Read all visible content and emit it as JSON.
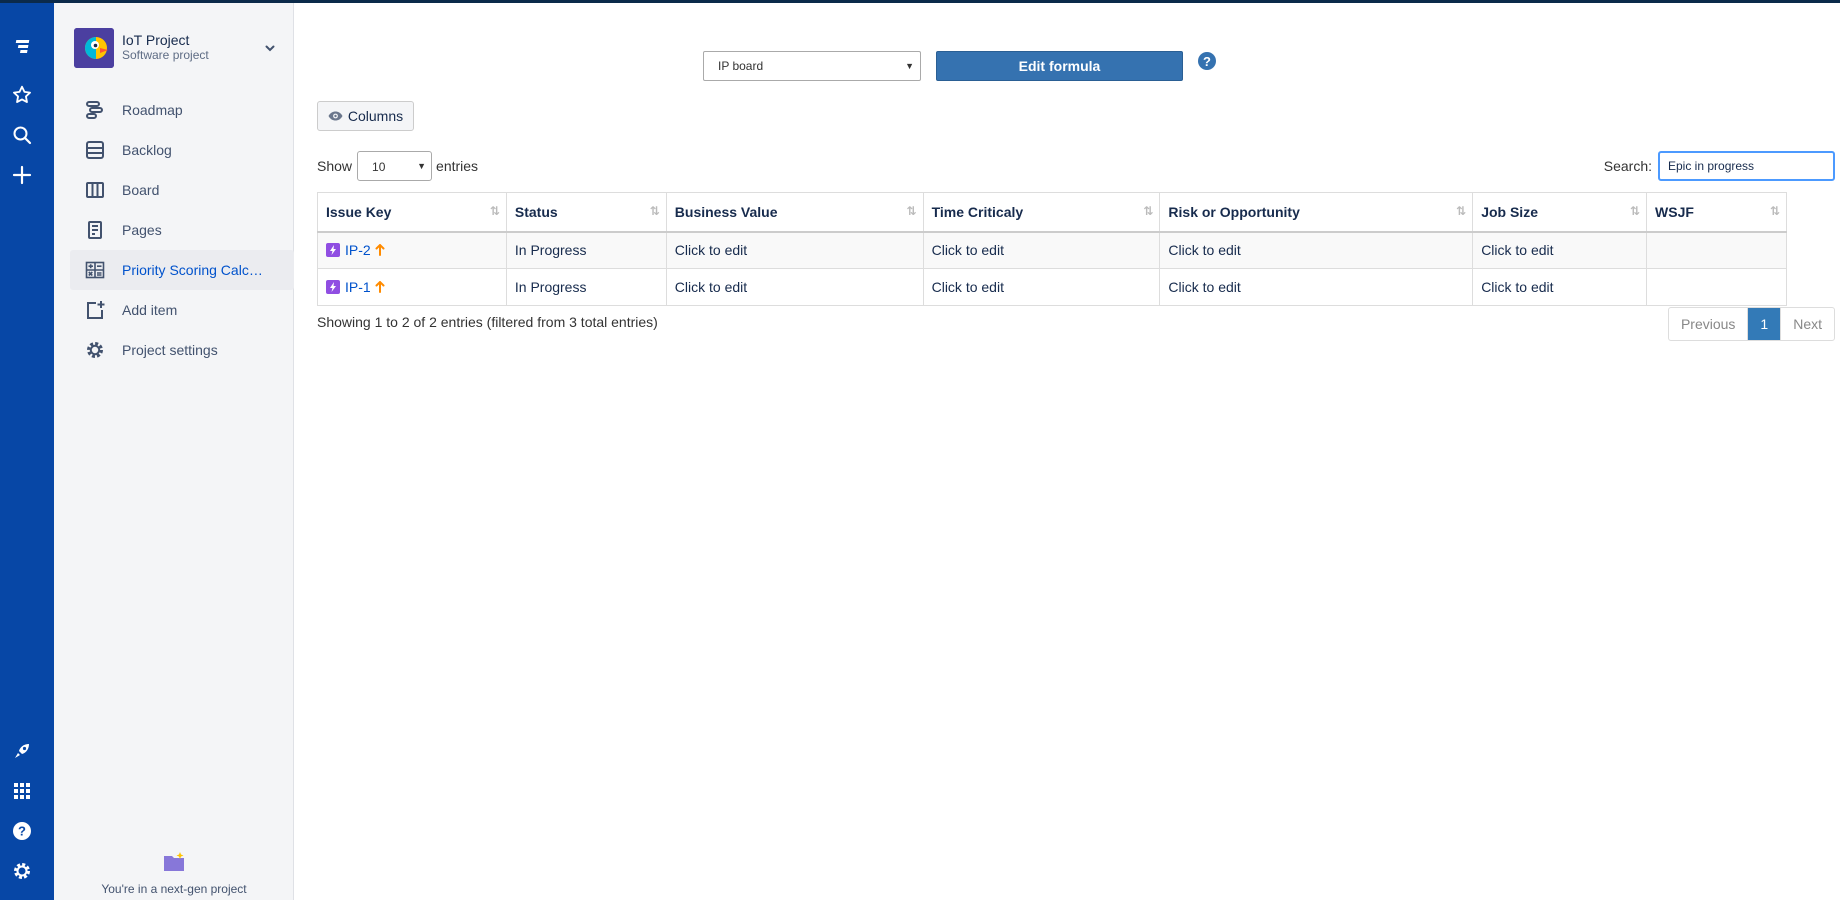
{
  "global_nav": {
    "icons": [
      "jira-logo-icon",
      "star-icon",
      "search-icon",
      "plus-icon",
      "rocket-icon",
      "apps-grid-icon",
      "help-icon",
      "settings-icon"
    ]
  },
  "project": {
    "name": "IoT Project",
    "type": "Software project"
  },
  "sidebar": {
    "items": [
      {
        "label": "Roadmap",
        "icon": "roadmap-icon"
      },
      {
        "label": "Backlog",
        "icon": "backlog-icon"
      },
      {
        "label": "Board",
        "icon": "board-icon"
      },
      {
        "label": "Pages",
        "icon": "pages-icon"
      },
      {
        "label": "Priority Scoring Calculator",
        "icon": "calculator-icon",
        "active": true
      },
      {
        "label": "Add item",
        "icon": "add-item-icon"
      },
      {
        "label": "Project settings",
        "icon": "gear-icon"
      }
    ],
    "footer_text": "You're in a next-gen project"
  },
  "toolbar": {
    "board_select": "IP board",
    "edit_formula_label": "Edit formula",
    "help_glyph": "?",
    "columns_label": "Columns"
  },
  "table_controls": {
    "show_label": "Show",
    "entries_value": "10",
    "entries_label": "entries",
    "search_label": "Search:",
    "search_value": "Epic in progress"
  },
  "table": {
    "headers": [
      "Issue Key",
      "Status",
      "Business Value",
      "Time Criticaly",
      "Risk or Opportunity",
      "Job Size",
      "WSJF"
    ],
    "rows": [
      {
        "key": "IP-2",
        "status": "In Progress",
        "business_value": "Click to edit",
        "time_criticality": "Click to edit",
        "risk": "Click to edit",
        "job_size": "Click to edit",
        "wsjf": ""
      },
      {
        "key": "IP-1",
        "status": "In Progress",
        "business_value": "Click to edit",
        "time_criticality": "Click to edit",
        "risk": "Click to edit",
        "job_size": "Click to edit",
        "wsjf": ""
      }
    ]
  },
  "footer": {
    "info": "Showing 1 to 2 of 2 entries (filtered from 3 total entries)",
    "previous": "Previous",
    "page": "1",
    "next": "Next"
  },
  "colors": {
    "rail": "#0747a6",
    "sidebar_bg": "#f4f5f7",
    "primary_button": "#3572b0",
    "link": "#0052cc",
    "epic": "#904ee2",
    "priority_high": "#ff8b00"
  }
}
